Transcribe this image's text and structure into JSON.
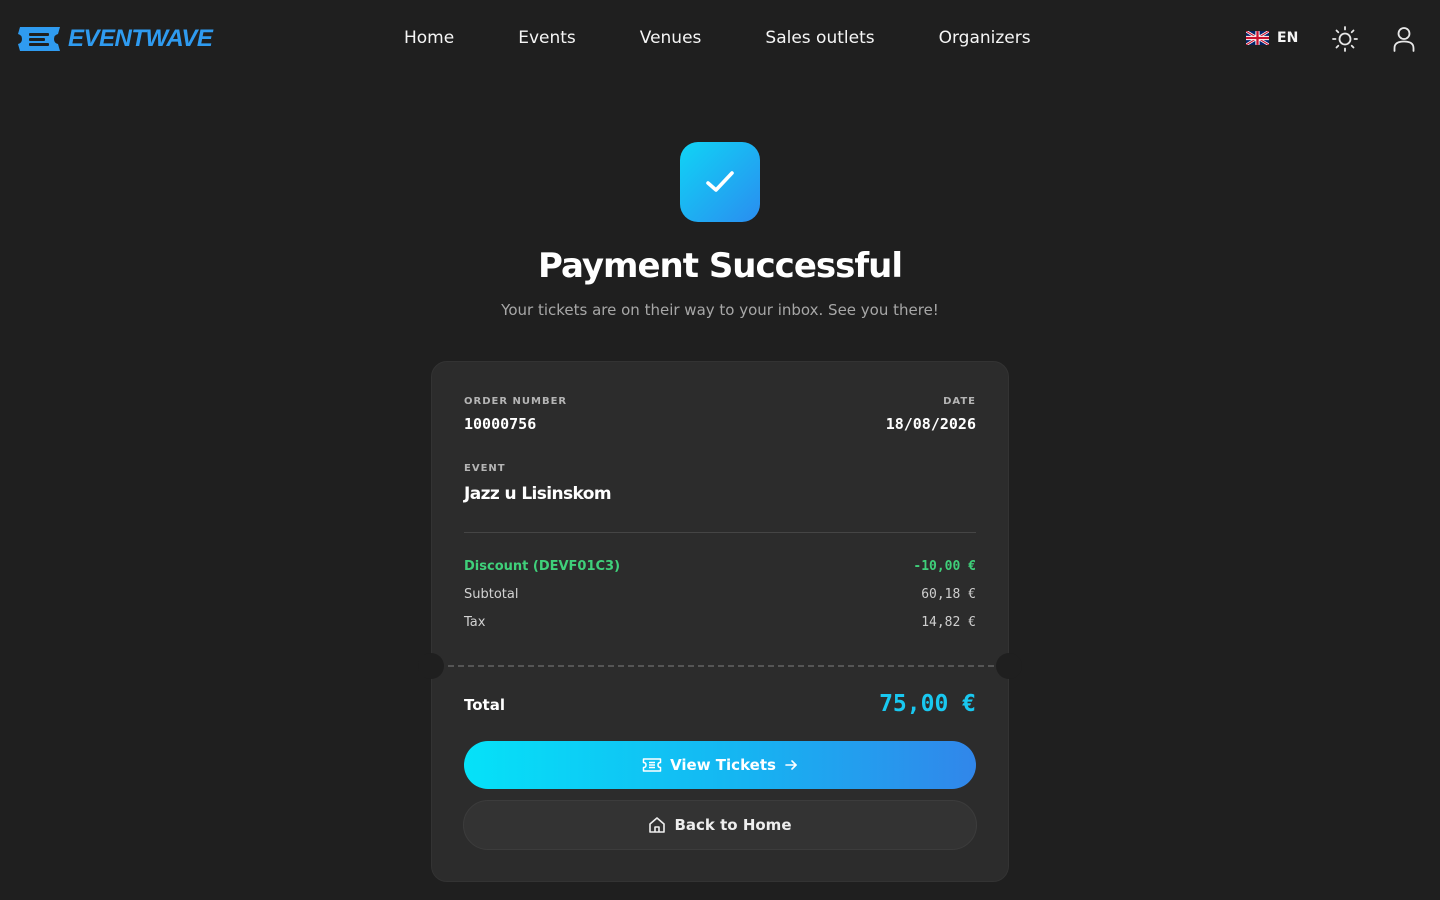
{
  "brand": {
    "name": "EVENTWAVE",
    "color": "#2f9bf0"
  },
  "nav": {
    "items": [
      {
        "label": "Home"
      },
      {
        "label": "Events"
      },
      {
        "label": "Venues"
      },
      {
        "label": "Sales outlets"
      },
      {
        "label": "Organizers"
      }
    ]
  },
  "header": {
    "language": {
      "code": "EN",
      "flag_icon": "uk-flag-icon"
    },
    "theme_toggle_icon": "sun-icon",
    "user_icon": "user-icon"
  },
  "hero": {
    "icon": "check-icon",
    "title": "Payment Successful",
    "subtitle": "Your tickets are on their way to your inbox. See you there!"
  },
  "order": {
    "order_number_label": "ORDER NUMBER",
    "order_number": "10000756",
    "date_label": "DATE",
    "date": "18/08/2026",
    "event_label": "EVENT",
    "event_name": "Jazz u Lisinskom",
    "discount_label": "Discount (DEVF01C3)",
    "discount_value": "-10,00 €",
    "subtotal_label": "Subtotal",
    "subtotal_value": "60,18 €",
    "tax_label": "Tax",
    "tax_value": "14,82 €",
    "total_label": "Total",
    "total_value": "75,00 €"
  },
  "actions": {
    "view_tickets": {
      "label": "View Tickets",
      "icon": "ticket-icon",
      "trailing_icon": "arrow-right-icon"
    },
    "back_home": {
      "label": "Back to Home",
      "icon": "home-icon"
    }
  },
  "colors": {
    "background": "#1f1f1f",
    "card": "#2c2c2c",
    "accent": "#19c8f0",
    "discount": "#3fd07a"
  }
}
